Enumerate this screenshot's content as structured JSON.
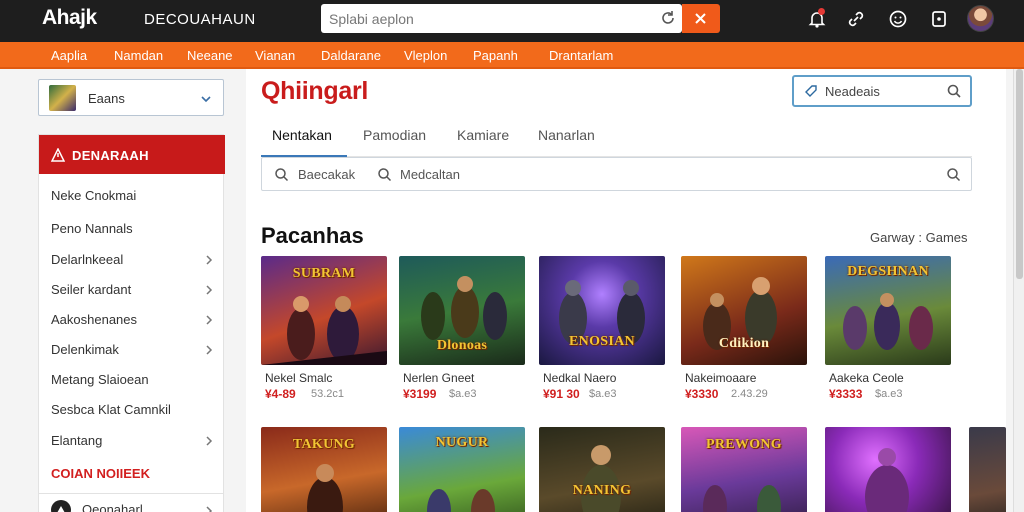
{
  "topbar": {
    "logo": "Ahajk",
    "logo_sub": "DECOUAHAUN",
    "search_value": "Splabi aeplon",
    "icons": [
      "refresh-icon",
      "close-icon",
      "bell-icon",
      "link-icon",
      "smile-icon",
      "wallet-icon",
      "avatar"
    ]
  },
  "nav": {
    "items": [
      "Aaplia",
      "Namdan",
      "Neeane",
      "Vianan",
      "Daldarane",
      "Vleplon",
      "Papanh",
      "Drantarlam"
    ]
  },
  "sidebar": {
    "user_label": "Eaans",
    "header": "DENARAAH",
    "items": [
      {
        "label": "Neke Cnokmai",
        "chevron": false
      },
      {
        "label": "Peno Nannals",
        "chevron": false
      },
      {
        "label": "Delarlnkeeal",
        "chevron": true
      },
      {
        "label": "Seiler kardant",
        "chevron": true
      },
      {
        "label": "Aakoshenanes",
        "chevron": true
      },
      {
        "label": "Delenkimak",
        "chevron": true
      },
      {
        "label": "Metang Slaioean",
        "chevron": false
      },
      {
        "label": "Sesbca Klat Camnkil",
        "chevron": false
      },
      {
        "label": "Elantang",
        "chevron": true
      }
    ],
    "red_link": "COIAN NOIIEEK",
    "bottom_label": "Qeonaharl"
  },
  "main": {
    "title": "Qhiingarl",
    "filter_label": "Neadeais",
    "tabs": [
      "Nentakan",
      "Pamodian",
      "Kamiare",
      "Nanarlan"
    ],
    "search_left": "Baecakak",
    "search_right": "Medcaltan",
    "section_title": "Pacanhas",
    "section_meta": "Garway : Games",
    "games_row1": [
      {
        "banner": "SUBRAM",
        "name": "Nekel Smalc",
        "price": "¥4-89",
        "orig": "53.2c1"
      },
      {
        "banner": "Dlonoas",
        "name": "Nerlen Gneet",
        "price": "¥3199",
        "orig": "$a.e3"
      },
      {
        "banner": "ENOSIAN",
        "name": "Nedkal Naero",
        "price": "¥91 30",
        "orig": "$a.e3"
      },
      {
        "banner": "Cdikion",
        "name": "Nakeimoaare",
        "price": "¥3330",
        "orig": "2.43.29"
      },
      {
        "banner": "DEGSHNAN",
        "name": "Aakeka Ceole",
        "price": "¥3333",
        "orig": "$a.e3"
      }
    ],
    "games_row2": [
      {
        "banner": "TAKUNG"
      },
      {
        "banner": "NUGUR"
      },
      {
        "banner": "NANING"
      },
      {
        "banner": "PREWONG"
      },
      {
        "banner": ""
      }
    ]
  },
  "colors": {
    "nav_orange": "#f26a1b",
    "brand_red": "#c91c1c",
    "topbar": "#1e1e1e",
    "accent_blue": "#3a78b8"
  }
}
